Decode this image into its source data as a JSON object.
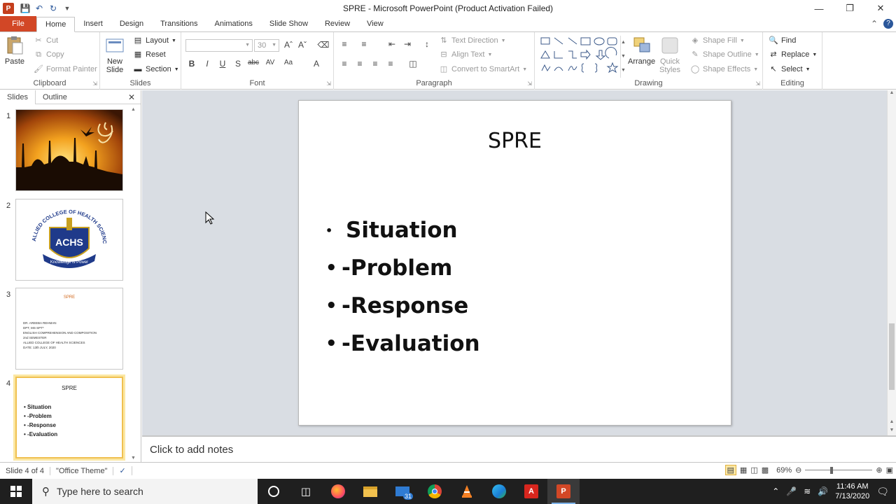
{
  "window": {
    "title": "SPRE  -  Microsoft PowerPoint (Product Activation Failed)"
  },
  "ribbon_tabs": [
    "File",
    "Home",
    "Insert",
    "Design",
    "Transitions",
    "Animations",
    "Slide Show",
    "Review",
    "View"
  ],
  "ribbon": {
    "clipboard": {
      "paste": "Paste",
      "cut": "Cut",
      "copy": "Copy",
      "format_painter": "Format Painter",
      "label": "Clipboard"
    },
    "slides": {
      "new_slide_1": "New",
      "new_slide_2": "Slide",
      "layout": "Layout",
      "reset": "Reset",
      "section": "Section",
      "label": "Slides"
    },
    "font": {
      "font_size": "30",
      "label": "Font"
    },
    "paragraph": {
      "text_direction": "Text Direction",
      "align_text": "Align Text",
      "convert_smartart": "Convert to SmartArt",
      "label": "Paragraph"
    },
    "drawing": {
      "arrange": "Arrange",
      "quick_styles_1": "Quick",
      "quick_styles_2": "Styles",
      "shape_fill": "Shape Fill",
      "shape_outline": "Shape Outline",
      "shape_effects": "Shape Effects",
      "label": "Drawing"
    },
    "editing": {
      "find": "Find",
      "replace": "Replace",
      "select": "Select",
      "label": "Editing"
    }
  },
  "left_panel": {
    "tabs": [
      "Slides",
      "Outline"
    ],
    "thumbnails": [
      {
        "number": "1"
      },
      {
        "number": "2",
        "logo_text": "ACHS",
        "ring_text": "ALLIED COLLEGE OF HEALTH SCIENCES",
        "motto": "Knowledge is Power"
      },
      {
        "number": "3",
        "title": "SPRE",
        "lines": [
          "DR. AREEBA REHMAN",
          "DPT, MS-SPT*",
          "ENGLISH COMPREHENSION AND COMPOSITION",
          "2nd SEMESTER",
          "ALLIED COLLEGE OF HEALTH SCIENCES",
          "DATE: 13th JULY, 2020"
        ]
      },
      {
        "number": "4",
        "title": "SPRE",
        "lines": [
          "Situation",
          "-Problem",
          "-Response",
          "-Evaluation"
        ]
      }
    ]
  },
  "slide": {
    "title": "SPRE",
    "bullets": [
      "Situation",
      "-Problem",
      "-Response",
      "-Evaluation"
    ]
  },
  "notes": {
    "placeholder": "Click to add notes"
  },
  "status": {
    "slide_of": "Slide 4 of 4",
    "theme": "\"Office Theme\"",
    "zoom": "69%"
  },
  "taskbar": {
    "search_placeholder": "Type here to search",
    "mail_badge": "31",
    "time": "11:46 AM",
    "date": "7/13/2020"
  }
}
